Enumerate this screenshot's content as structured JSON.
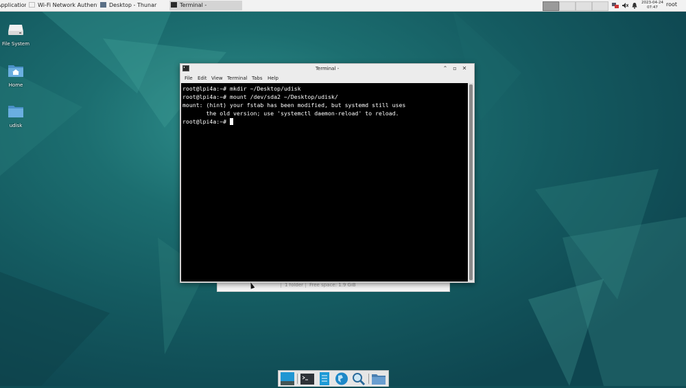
{
  "top_panel": {
    "tasks": [
      {
        "label": "Applications"
      },
      {
        "label": "Wi-Fi Network Authentica..."
      },
      {
        "label": "Desktop - Thunar"
      },
      {
        "label": "Terminal -"
      }
    ],
    "clock_date": "2023-04-24",
    "clock_time": "07:47",
    "user": "root"
  },
  "desktop_icons": [
    {
      "label": "File System",
      "icon": "drive-icon"
    },
    {
      "label": "Home",
      "icon": "home-folder-icon"
    },
    {
      "label": "udisk",
      "icon": "folder-icon"
    }
  ],
  "thunar_status": {
    "items": "1 folder",
    "free": "Free space: 1.9 GiB"
  },
  "terminal": {
    "title": "Terminal -",
    "menu": [
      "File",
      "Edit",
      "View",
      "Terminal",
      "Tabs",
      "Help"
    ],
    "lines": [
      "root@lpi4a:~# mkdir ~/Desktop/udisk",
      "root@lpi4a:~# mount /dev/sda2 ~/Desktop/udisk/",
      "mount: (hint) your fstab has been modified, but systemd still uses",
      "       the old version; use 'systemctl daemon-reload' to reload.",
      "root@lpi4a:~# "
    ]
  },
  "colors": {
    "panel": "#f2f2f2",
    "wallpaper": "#145a60",
    "terminal_bg": "#000000",
    "accent": "#1e90c8"
  }
}
